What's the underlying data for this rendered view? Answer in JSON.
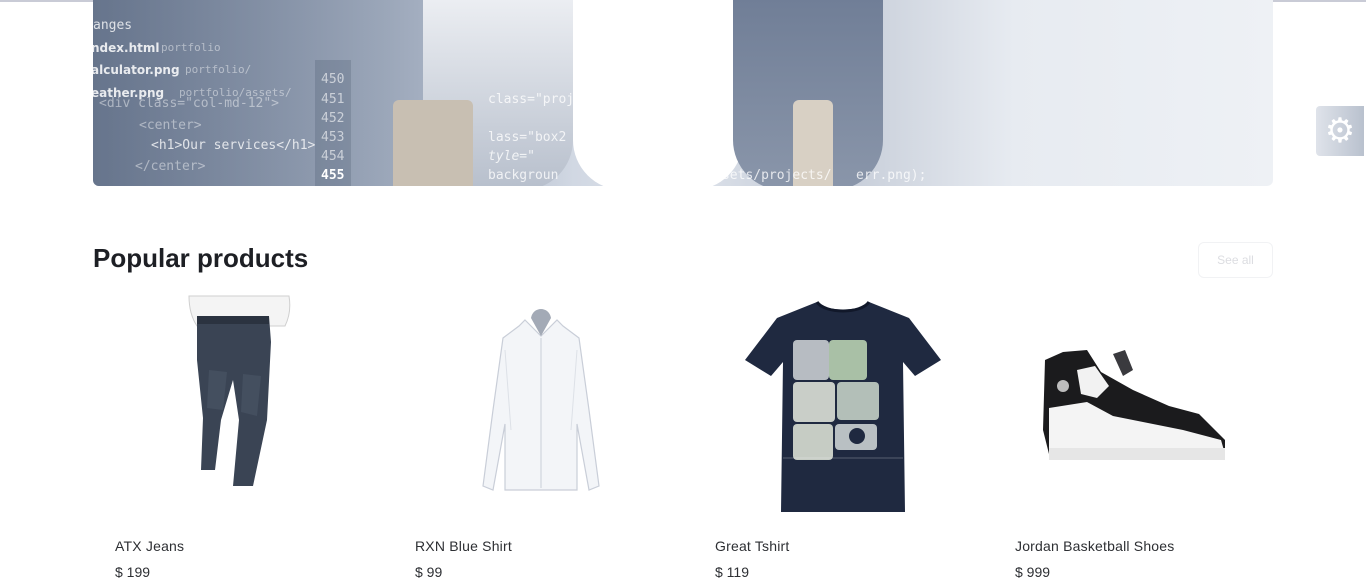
{
  "hero": {
    "code_lines": [
      "anges",
      "ndex.html",
      "portfolio",
      "alculator.png",
      "portfolio/",
      "eather.png",
      "portfolio/assets/",
      "<div class=\"col-md-12\">",
      "<center>",
      "<h1>Our services</h1>",
      "</center>",
      "class=\"proj",
      "lass=\"box2",
      "tyle=\"",
      "backgroun",
      "url(assets/projects/",
      "err.png);"
    ],
    "line_numbers": [
      "450",
      "451",
      "452",
      "453",
      "454",
      "455"
    ]
  },
  "settings": {
    "icon": "gear-icon",
    "glyph": "⚙"
  },
  "section": {
    "title": "Popular products",
    "see_all_label": "See all"
  },
  "products": [
    {
      "name": "ATX Jeans",
      "price": "$ 199",
      "icon": "jeans-image"
    },
    {
      "name": "RXN Blue Shirt",
      "price": "$ 99",
      "icon": "shirt-image"
    },
    {
      "name": "Great Tshirt",
      "price": "$ 119",
      "icon": "tshirt-image"
    },
    {
      "name": "Jordan Basketball Shoes",
      "price": "$ 999",
      "icon": "shoe-image"
    }
  ]
}
